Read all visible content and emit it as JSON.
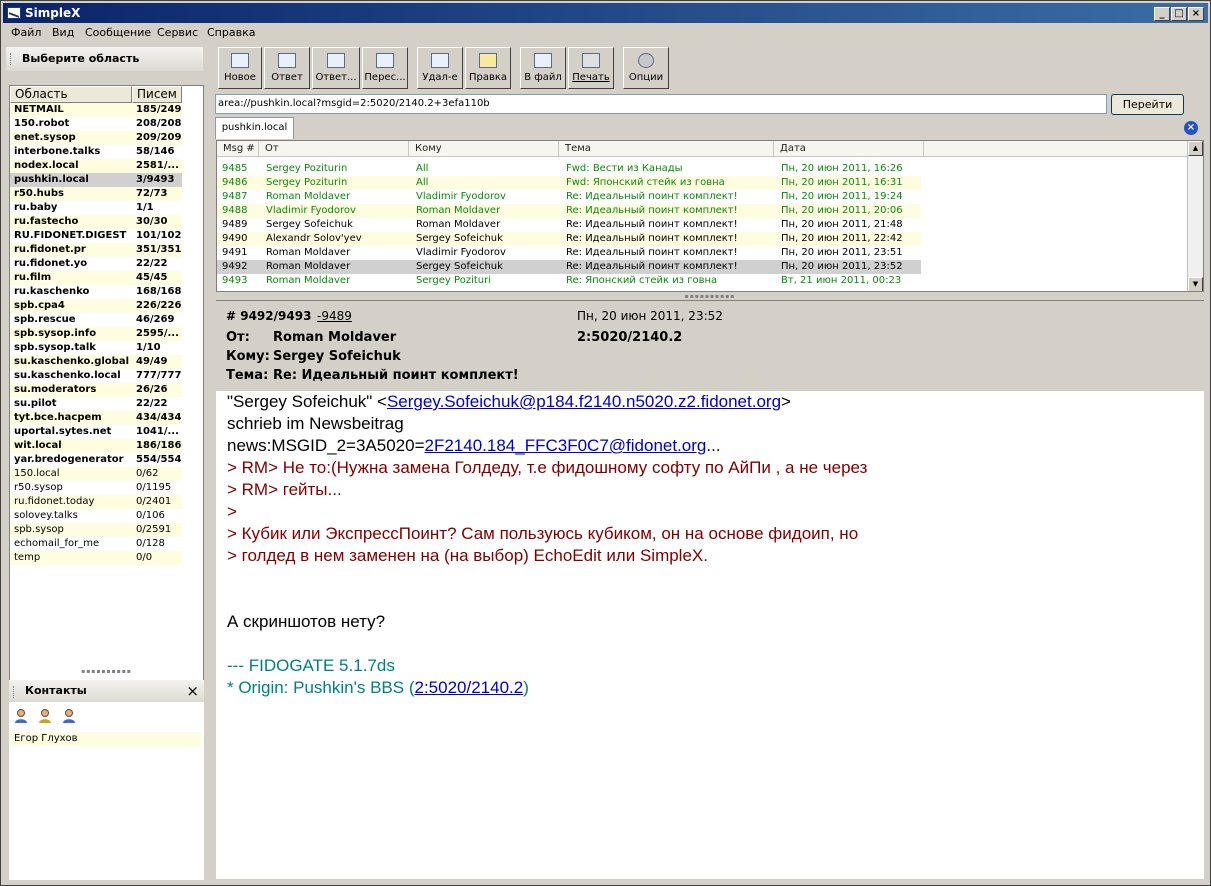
{
  "window": {
    "title": "SimpleX"
  },
  "menu": [
    "Файл",
    "Вид",
    "Сообщение",
    "Сервис",
    "Справка"
  ],
  "left": {
    "areas_title": "Выберите область",
    "col_area": "Область",
    "col_count": "Писем",
    "areas": [
      {
        "name": "NETMAIL",
        "count": "185/249",
        "bold": true
      },
      {
        "name": "150.robot",
        "count": "208/208",
        "bold": true
      },
      {
        "name": "enet.sysop",
        "count": "209/209",
        "bold": true
      },
      {
        "name": "interbone.talks",
        "count": "58/146",
        "bold": true
      },
      {
        "name": "nodex.local",
        "count": "2581/...",
        "bold": true
      },
      {
        "name": "pushkin.local",
        "count": "3/9493",
        "bold": true,
        "selected": true
      },
      {
        "name": "r50.hubs",
        "count": "72/73",
        "bold": true
      },
      {
        "name": "ru.baby",
        "count": "1/1",
        "bold": true
      },
      {
        "name": "ru.fastecho",
        "count": "30/30",
        "bold": true
      },
      {
        "name": "RU.FIDONET.DIGEST",
        "count": "101/102",
        "bold": true
      },
      {
        "name": "ru.fidonet.pr",
        "count": "351/351",
        "bold": true
      },
      {
        "name": "ru.fidonet.yo",
        "count": "22/22",
        "bold": true
      },
      {
        "name": "ru.film",
        "count": "45/45",
        "bold": true
      },
      {
        "name": "ru.kaschenko",
        "count": "168/168",
        "bold": true
      },
      {
        "name": "spb.cpa4",
        "count": "226/226",
        "bold": true
      },
      {
        "name": "spb.rescue",
        "count": "46/269",
        "bold": true
      },
      {
        "name": "spb.sysop.info",
        "count": "2595/...",
        "bold": true
      },
      {
        "name": "spb.sysop.talk",
        "count": "1/10",
        "bold": true
      },
      {
        "name": "su.kaschenko.global",
        "count": "49/49",
        "bold": true
      },
      {
        "name": "su.kaschenko.local",
        "count": "777/777",
        "bold": true
      },
      {
        "name": "su.moderators",
        "count": "26/26",
        "bold": true
      },
      {
        "name": "su.pilot",
        "count": "22/22",
        "bold": true
      },
      {
        "name": "tyt.bce.hacpem",
        "count": "434/434",
        "bold": true
      },
      {
        "name": "uportal.sytes.net",
        "count": "1041/...",
        "bold": true
      },
      {
        "name": "wit.local",
        "count": "186/186",
        "bold": true
      },
      {
        "name": "yar.bredogenerator",
        "count": "554/554",
        "bold": true
      },
      {
        "name": "150.local",
        "count": "0/62",
        "bold": false
      },
      {
        "name": "r50.sysop",
        "count": "0/1195",
        "bold": false
      },
      {
        "name": "ru.fidonet.today",
        "count": "0/2401",
        "bold": false
      },
      {
        "name": "solovey.talks",
        "count": "0/106",
        "bold": false
      },
      {
        "name": "spb.sysop",
        "count": "0/2591",
        "bold": false
      },
      {
        "name": "echomail_for_me",
        "count": "0/128",
        "bold": false
      },
      {
        "name": "temp",
        "count": "0/0",
        "bold": false
      }
    ],
    "contacts_title": "Контакты",
    "contacts": [
      "Егор Глухов"
    ]
  },
  "toolbar": [
    "Новое",
    "Ответ",
    "Ответ...",
    "Перес...",
    "Удал-е",
    "Правка",
    "В файл",
    "Печать",
    "Опции"
  ],
  "address": {
    "value": "area://pushkin.local?msgid=2:5020/2140.2+3efa110b",
    "go": "Перейти"
  },
  "tab": "pushkin.local",
  "list": {
    "columns": [
      "Msg #",
      "От",
      "Кому",
      "Тема",
      "Дата"
    ],
    "rows": [
      {
        "n": "9485",
        "from": "Sergey Poziturin",
        "to": "All",
        "subj": "Fwd: Вести из Канады",
        "date": "Пн, 20 июн 2011, 16:26",
        "unread": true
      },
      {
        "n": "9486",
        "from": "Sergey Poziturin",
        "to": "All",
        "subj": "Fwd: Японский стейк из говна",
        "date": "Пн, 20 июн 2011, 16:31",
        "unread": true
      },
      {
        "n": "9487",
        "from": "Roman Moldaver",
        "to": "Vladimir Fyodorov",
        "subj": "Re: Идеальный поинт комплект!",
        "date": "Пн, 20 июн 2011, 19:24",
        "unread": true
      },
      {
        "n": "9488",
        "from": "Vladimir Fyodorov",
        "to": "Roman Moldaver",
        "subj": "Re: Идеальный поинт комплект!",
        "date": "Пн, 20 июн 2011, 20:06",
        "unread": true
      },
      {
        "n": "9489",
        "from": "Sergey Sofeichuk",
        "to": "Roman Moldaver",
        "subj": "Re: Идеальный поинт комплект!",
        "date": "Пн, 20 июн 2011, 21:48",
        "unread": false
      },
      {
        "n": "9490",
        "from": "Alexandr Solov'yev",
        "to": "Sergey Sofeichuk",
        "subj": "Re: Идеальный поинт комплект!",
        "date": "Пн, 20 июн 2011, 22:42",
        "unread": false
      },
      {
        "n": "9491",
        "from": "Roman Moldaver",
        "to": "Vladimir Fyodorov",
        "subj": "Re: Идеальный поинт комплект!",
        "date": "Пн, 20 июн 2011, 23:51",
        "unread": false
      },
      {
        "n": "9492",
        "from": "Roman Moldaver",
        "to": "Sergey Sofeichuk",
        "subj": "Re: Идеальный поинт комплект!",
        "date": "Пн, 20 июн 2011, 23:52",
        "unread": false,
        "selected": true
      },
      {
        "n": "9493",
        "from": "Roman Moldaver",
        "to": "Sergey Pozituri",
        "subj": "Re: Японский стейк из говна",
        "date": "Вт, 21 июн 2011, 00:23",
        "unread": true
      }
    ]
  },
  "message": {
    "num": "# 9492/9493",
    "prev": "-9489",
    "date": "Пн, 20 июн 2011, 23:52",
    "from_label": "От:",
    "from": "Roman Moldaver",
    "addr": "2:5020/2140.2",
    "to_label": "Кому:",
    "to": "Sergey Sofeichuk",
    "subj_label": "Тема:",
    "subj": "Re: Идеальный поинт комплект!",
    "body": {
      "l1a": "\"Sergey Sofeichuk\" <",
      "l1link": "Sergey.Sofeichuk@p184.f2140.n5020.z2.fidonet.org",
      "l1b": ">",
      "l2": "schrieb im Newsbeitrag",
      "l3a": "news:MSGID_2=3A5020=",
      "l3link": "2F2140.184_FFC3F0C7@fidonet.org",
      "l3b": "...",
      "q1": "> RM> Не то:(Нужна замена Голдеду, т.е фидошному софту по АйПи , а не через",
      "q2": "> RM> гейты...",
      "q3": ">",
      "q4": "> Кубик или ЭкспрессПоинт? Сам пользуюсь кубиком, он на основе фидоип, но",
      "q5": "> голдед в нем заменен на (на выбор) EchoEdit или SimpleX.",
      "text": "А скриншотов нету?",
      "tear": "--- FIDOGATE 5.1.7ds",
      "origin_a": " * Origin: Pushkin's BBS (",
      "origin_link": "2:5020/2140.2",
      "origin_b": ")"
    }
  }
}
